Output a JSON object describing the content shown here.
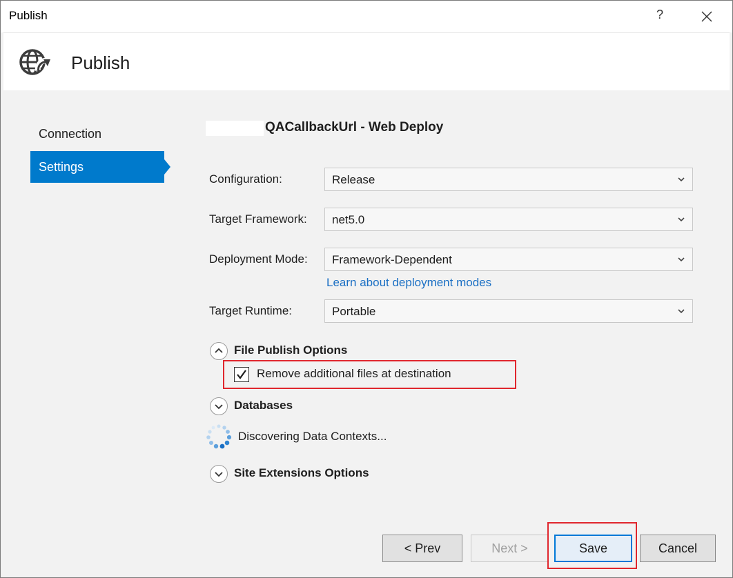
{
  "window": {
    "title": "Publish",
    "help_label": "?"
  },
  "header": {
    "title": "Publish",
    "icon": "globe-publish-icon"
  },
  "sidebar": {
    "items": [
      {
        "label": "Connection",
        "active": false
      },
      {
        "label": "Settings",
        "active": true
      }
    ]
  },
  "profile": {
    "title": "QACallbackUrl - Web Deploy"
  },
  "form": {
    "configuration": {
      "label": "Configuration:",
      "value": "Release"
    },
    "target_framework": {
      "label": "Target Framework:",
      "value": "net5.0"
    },
    "deployment_mode": {
      "label": "Deployment Mode:",
      "value": "Framework-Dependent"
    },
    "deployment_link": "Learn about deployment modes",
    "target_runtime": {
      "label": "Target Runtime:",
      "value": "Portable"
    }
  },
  "sections": {
    "file_publish": {
      "title": "File Publish Options",
      "expanded": true,
      "remove_files_label": "Remove additional files at destination",
      "remove_files_checked": true
    },
    "databases": {
      "title": "Databases",
      "expanded": false,
      "status": "Discovering Data Contexts..."
    },
    "site_extensions": {
      "title": "Site Extensions Options",
      "expanded": false
    }
  },
  "buttons": {
    "prev": "< Prev",
    "next": "Next >",
    "save": "Save",
    "cancel": "Cancel"
  },
  "colors": {
    "accent": "#007acc",
    "link": "#1a6fc4",
    "highlight": "#e0262d"
  }
}
